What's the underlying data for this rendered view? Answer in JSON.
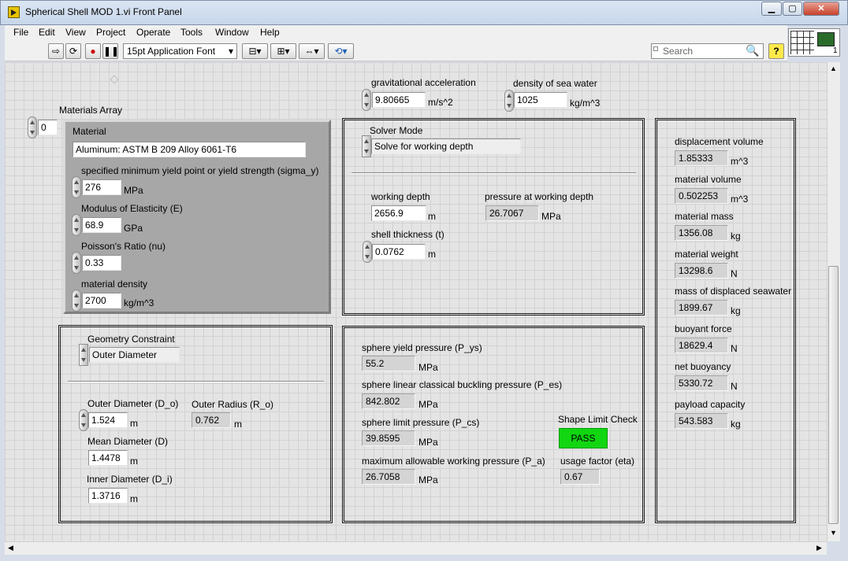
{
  "window": {
    "title": "Spherical Shell MOD 1.vi Front Panel",
    "min": "▁",
    "max": "▢",
    "close": "✕"
  },
  "menu": [
    "File",
    "Edit",
    "View",
    "Project",
    "Operate",
    "Tools",
    "Window",
    "Help"
  ],
  "toolbar": {
    "font": "15pt Application Font",
    "search_placeholder": "Search",
    "help": "?",
    "conn_num": "1"
  },
  "inputs": {
    "gravity": {
      "label": "gravitational acceleration",
      "value": "9.80665",
      "unit": "m/s^2"
    },
    "seawater": {
      "label": "density of sea water",
      "value": "1025",
      "unit": "kg/m^3"
    }
  },
  "materials": {
    "array_label": "Materials Array",
    "index": "0",
    "cluster_label": "Material",
    "name": "Aluminum:  ASTM B 209 Alloy 6061-T6",
    "yield": {
      "label": "specified minimum yield point or yield strength (sigma_y)",
      "value": "276",
      "unit": "MPa"
    },
    "modulus": {
      "label": "Modulus of Elasticity (E)",
      "value": "68.9",
      "unit": "GPa"
    },
    "poisson": {
      "label": "Poisson's Ratio (nu)",
      "value": "0.33"
    },
    "density": {
      "label": "material density",
      "value": "2700",
      "unit": "kg/m^3"
    }
  },
  "solver": {
    "mode_label": "Solver Mode",
    "mode_value": "Solve for working depth",
    "depth": {
      "label": "working depth",
      "value": "2656.9",
      "unit": "m"
    },
    "pressure": {
      "label": "pressure at working depth",
      "value": "26.7067",
      "unit": "MPa"
    },
    "thickness": {
      "label": "shell thickness (t)",
      "value": "0.0762",
      "unit": "m"
    }
  },
  "geometry": {
    "constraint_label": "Geometry Constraint",
    "constraint_value": "Outer Diameter",
    "outer_d": {
      "label": "Outer Diameter (D_o)",
      "value": "1.524",
      "unit": "m"
    },
    "outer_r": {
      "label": "Outer Radius (R_o)",
      "value": "0.762",
      "unit": "m"
    },
    "mean_d": {
      "label": "Mean Diameter (D)",
      "value": "1.4478",
      "unit": "m"
    },
    "inner_d": {
      "label": "Inner Diameter (D_i)",
      "value": "1.3716",
      "unit": "m"
    }
  },
  "pressures": {
    "p_ys": {
      "label": "sphere yield pressure (P_ys)",
      "value": "55.2",
      "unit": "MPa"
    },
    "p_es": {
      "label": "sphere linear classical buckling pressure (P_es)",
      "value": "842.802",
      "unit": "MPa"
    },
    "p_cs": {
      "label": "sphere limit pressure (P_cs)",
      "value": "39.8595",
      "unit": "MPa"
    },
    "p_a": {
      "label": "maximum allowable working pressure (P_a)",
      "value": "26.7058",
      "unit": "MPa"
    },
    "shape_check": {
      "label": "Shape Limit Check",
      "value": "PASS",
      "color": "#11d611"
    },
    "eta": {
      "label": "usage factor (eta)",
      "value": "0.67"
    }
  },
  "results": [
    {
      "label": "displacement volume",
      "value": "1.85333",
      "unit": "m^3"
    },
    {
      "label": "material volume",
      "value": "0.502253",
      "unit": "m^3"
    },
    {
      "label": "material mass",
      "value": "1356.08",
      "unit": "kg"
    },
    {
      "label": "material weight",
      "value": "13298.6",
      "unit": "N"
    },
    {
      "label": "mass of displaced seawater",
      "value": "1899.67",
      "unit": "kg"
    },
    {
      "label": "buoyant force",
      "value": "18629.4",
      "unit": "N"
    },
    {
      "label": "net buoyancy",
      "value": "5330.72",
      "unit": "N"
    },
    {
      "label": "payload capacity",
      "value": "543.583",
      "unit": "kg"
    }
  ]
}
